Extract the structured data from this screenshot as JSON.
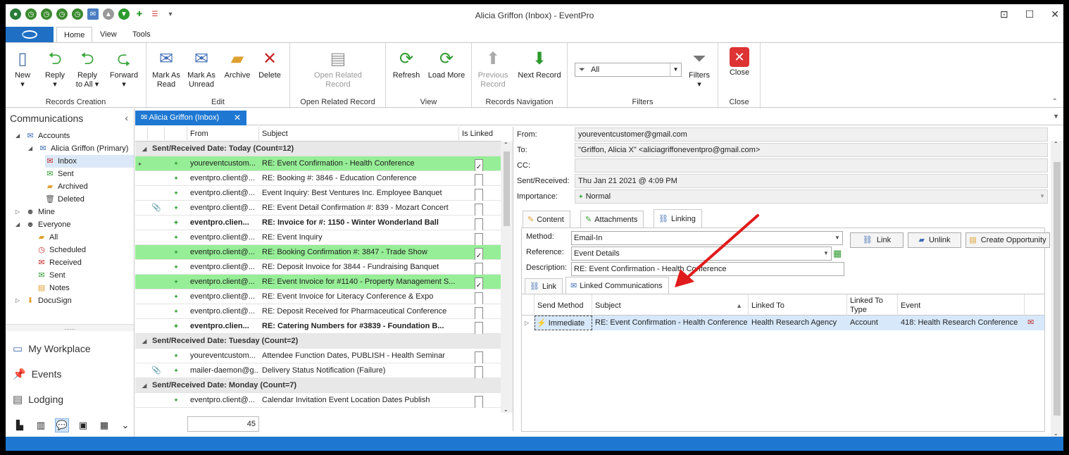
{
  "window": {
    "title": "Alicia Griffon (Inbox) - EventPro"
  },
  "ribbon_tabs": [
    "Home",
    "View",
    "Tools"
  ],
  "ribbon": {
    "groups": {
      "records_creation": "Records Creation",
      "edit": "Edit",
      "open_related": "Open Related Record",
      "view": "View",
      "records_navigation": "Records Navigation",
      "filters": "Filters",
      "close": "Close"
    },
    "buttons": {
      "new": "New",
      "reply": "Reply",
      "reply_all_1": "Reply",
      "reply_all_2": "to All",
      "forward": "Forward",
      "mark_read_1": "Mark As",
      "mark_read_2": "Read",
      "mark_unread_1": "Mark As",
      "mark_unread_2": "Unread",
      "archive": "Archive",
      "delete": "Delete",
      "open_related_1": "Open Related",
      "open_related_2": "Record",
      "refresh": "Refresh",
      "load_more": "Load More",
      "previous_1": "Previous",
      "previous_2": "Record",
      "next_record": "Next Record",
      "filters": "Filters",
      "close": "Close"
    },
    "filter_value": "All"
  },
  "nav": {
    "title": "Communications",
    "tree": {
      "accounts": "Accounts",
      "primary": "Alicia Griffon (Primary)",
      "inbox": "Inbox",
      "sent": "Sent",
      "archived": "Archived",
      "deleted": "Deleted",
      "mine": "Mine",
      "everyone": "Everyone",
      "all": "All",
      "scheduled": "Scheduled",
      "received": "Received",
      "sent2": "Sent",
      "notes": "Notes",
      "docusign": "DocuSign"
    },
    "separator": "......",
    "workplace": "My Workplace",
    "events": "Events",
    "lodging": "Lodging"
  },
  "doc_tab": "Alicia Griffon (Inbox)",
  "grid": {
    "headers": {
      "from": "From",
      "subject": "Subject",
      "is_linked": "Is Linked"
    },
    "group_today": "Sent/Received Date: Today (Count=12)",
    "group_tuesday": "Sent/Received Date: Tuesday (Count=2)",
    "group_monday": "Sent/Received Date: Monday (Count=7)",
    "rows": [
      {
        "from": "youreventcustom...",
        "subject": "RE: Event Confirmation - Health Conference"
      },
      {
        "from": "eventpro.client@...",
        "subject": "RE: Booking #: 3846 - Education Conference"
      },
      {
        "from": "eventpro.client@...",
        "subject": "Event Inquiry: Best Ventures Inc. Employee Banquet"
      },
      {
        "from": "eventpro.client@...",
        "subject": "RE: Event Detail Confirmation #: 839 - Mozart Concert"
      },
      {
        "from": "eventpro.clien...",
        "subject": "RE: Invoice for #: 1150 - Winter Wonderland Ball"
      },
      {
        "from": "eventpro.client@...",
        "subject": "RE: Event Inquiry"
      },
      {
        "from": "eventpro.client@...",
        "subject": "RE: Booking Confirmation #: 3847 - Trade Show"
      },
      {
        "from": "eventpro.client@...",
        "subject": "RE: Deposit Invoice for 3844 - Fundraising Banquet"
      },
      {
        "from": "eventpro.client@...",
        "subject": "RE: Event Invoice for #1140 - Property Management S..."
      },
      {
        "from": "eventpro.client@...",
        "subject": "RE: Event Invoice for Literacy Conference & Expo"
      },
      {
        "from": "eventpro.client@...",
        "subject": "RE: Deposit Received for Pharmaceutical Conference"
      },
      {
        "from": "eventpro.clien...",
        "subject": "RE: Catering Numbers for #3839 - Foundation B..."
      },
      {
        "from": "youreventcustom...",
        "subject": "Attendee Function Dates, PUBLISH - Health Seminar"
      },
      {
        "from": "mailer-daemon@g...",
        "subject": "Delivery Status Notification (Failure)"
      },
      {
        "from": "eventpro.client@...",
        "subject": "Calendar Invitation Event Location Dates Publish"
      }
    ],
    "footer_count": "45"
  },
  "detail": {
    "labels": {
      "from": "From:",
      "to": "To:",
      "cc": "CC:",
      "sent": "Sent/Received:",
      "importance": "Importance:"
    },
    "from": "youreventcustomer@gmail.com",
    "to": "\"Griffon, Alicia X\" <aliciagriffoneventpro@gmail.com>",
    "cc": "",
    "sent": "Thu Jan 21 2021 @ 4:09 PM",
    "importance": "Normal",
    "tabs": {
      "content": "Content",
      "attachments": "Attachments",
      "linking": "Linking"
    },
    "linking": {
      "method_label": "Method:",
      "method": "Email-In",
      "reference_label": "Reference:",
      "reference": "Event Details",
      "description_label": "Description:",
      "description": "RE: Event Confirmation - Health Conference",
      "link_btn": "Link",
      "unlink_btn": "Unlink",
      "create_opp_btn": "Create Opportunity",
      "subtabs": {
        "link": "Link",
        "linked": "Linked Communications"
      },
      "headers": {
        "send_method": "Send Method",
        "subject": "Subject",
        "linked_to": "Linked To",
        "linked_to_type": "Linked To Type",
        "event": "Event"
      },
      "row": {
        "send_method": "Immediate",
        "subject": "RE: Event Confirmation - Health Conference",
        "linked_to": "Health Research Agency",
        "linked_to_type": "Account",
        "event": "418: Health Research Conference"
      }
    }
  },
  "colors": {
    "accent": "#1e78d2",
    "highlight_row": "#96ee96",
    "arrow": "#e01b1b"
  }
}
